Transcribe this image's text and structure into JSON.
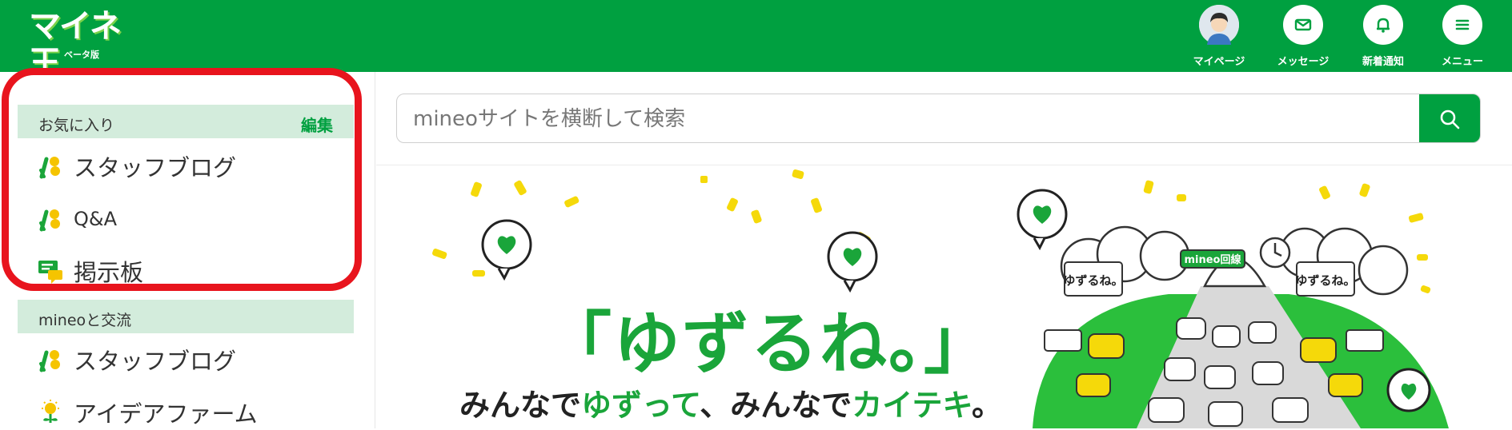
{
  "header": {
    "logo_text": "マイネ王",
    "logo_sub": "ベータ版",
    "nav": [
      {
        "label": "マイページ",
        "icon": "avatar"
      },
      {
        "label": "メッセージ",
        "icon": "mail-icon"
      },
      {
        "label": "新着通知",
        "icon": "bell-icon"
      },
      {
        "label": "メニュー",
        "icon": "menu-icon"
      }
    ]
  },
  "sidebar": {
    "favorites": {
      "title": "お気に入り",
      "edit": "編集",
      "items": [
        {
          "label": "スタッフブログ",
          "icon": "staff-blog-icon"
        },
        {
          "label": "Q&A",
          "icon": "qa-icon"
        },
        {
          "label": "掲示板",
          "icon": "board-icon"
        }
      ]
    },
    "community": {
      "title": "mineoと交流",
      "items": [
        {
          "label": "スタッフブログ",
          "icon": "staff-blog-icon"
        },
        {
          "label": "アイデアファーム",
          "icon": "idea-farm-icon"
        }
      ]
    }
  },
  "search": {
    "placeholder": "mineoサイトを横断して検索"
  },
  "banner": {
    "title": "「ゆずるね。」",
    "subtitle_parts": [
      "みんなで",
      "ゆずって",
      "、みんなで",
      "カイテキ",
      "。"
    ],
    "sign_text": "mineo回線",
    "bubble_label": "ゆずるね。"
  },
  "colors": {
    "brand_green": "#00a040",
    "highlight_red": "#e8141d",
    "section_bg": "#d3ecdc"
  }
}
